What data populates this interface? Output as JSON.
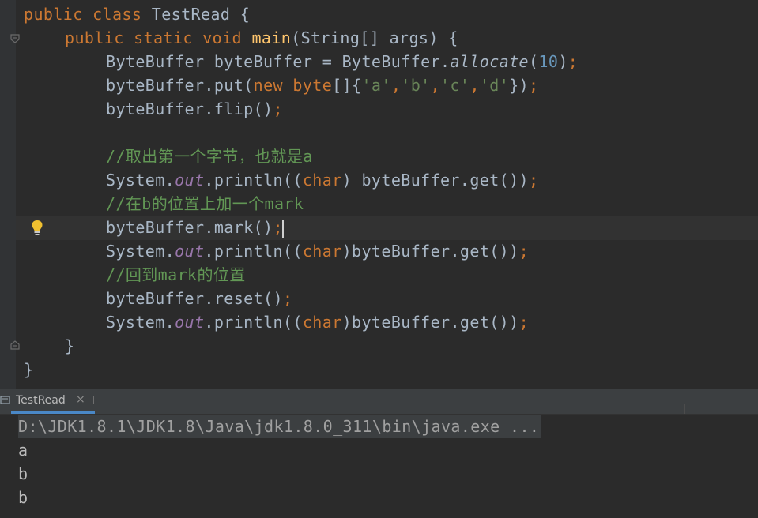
{
  "colors": {
    "editor_bg": "#2b2b2b",
    "keyword": "#cc7832",
    "method_decl": "#ffc66d",
    "string": "#6a8759",
    "number": "#6897bb",
    "comment": "#629755",
    "static_field": "#9876aa",
    "text": "#a9b7c6",
    "tab_accent": "#4a88c7"
  },
  "editor": {
    "l1": {
      "kw1": "public",
      "kw2": "class",
      "rest": " TestRead {"
    },
    "l2": {
      "kw1": "public",
      "kw2": "static",
      "kw3": "void",
      "fn": "main",
      "rest": "(String[] args) {"
    },
    "l3": {
      "a": "ByteBuffer byteBuffer = ByteBuffer.",
      "b": "allocate",
      "c": "(",
      "num": "10",
      "d": ")",
      "semi": ";"
    },
    "l4": {
      "a": "byteBuffer.put(",
      "kw": "new byte",
      "b": "[]{",
      "s1": "'a'",
      "c1": ",",
      "s2": "'b'",
      "c2": ",",
      "s3": "'c'",
      "c3": ",",
      "s4": "'d'",
      "d": "})",
      "semi": ";"
    },
    "l5": {
      "a": "byteBuffer.flip()",
      "semi": ";"
    },
    "l7": {
      "comment": "//取出第一个字节，也就是a"
    },
    "l8": {
      "a": "System.",
      "fld": "out",
      "b": ".println((",
      "kw": "char",
      "c": ") byteBuffer.get())",
      "semi": ";"
    },
    "l9": {
      "comment": "//在b的位置上加一个mark"
    },
    "l10": {
      "a": "byteBuffer.mark()",
      "semi": ";"
    },
    "l11": {
      "a": "System.",
      "fld": "out",
      "b": ".println((",
      "kw": "char",
      "c": ")byteBuffer.get())",
      "semi": ";"
    },
    "l12": {
      "comment": "//回到mark的位置"
    },
    "l13": {
      "a": "byteBuffer.reset()",
      "semi": ";"
    },
    "l14": {
      "a": "System.",
      "fld": "out",
      "b": ".println((",
      "kw": "char",
      "c": ")byteBuffer.get())",
      "semi": ";"
    },
    "l15": {
      "a": "}"
    },
    "l16": {
      "a": "}"
    }
  },
  "tool_window": {
    "tab_label": "TestRead",
    "close_glyph": "×"
  },
  "console": {
    "command": "D:\\JDK1.8.1\\JDK1.8\\Java\\jdk1.8.0_311\\bin\\java.exe ...",
    "outputs": [
      "a",
      "b",
      "b"
    ]
  }
}
